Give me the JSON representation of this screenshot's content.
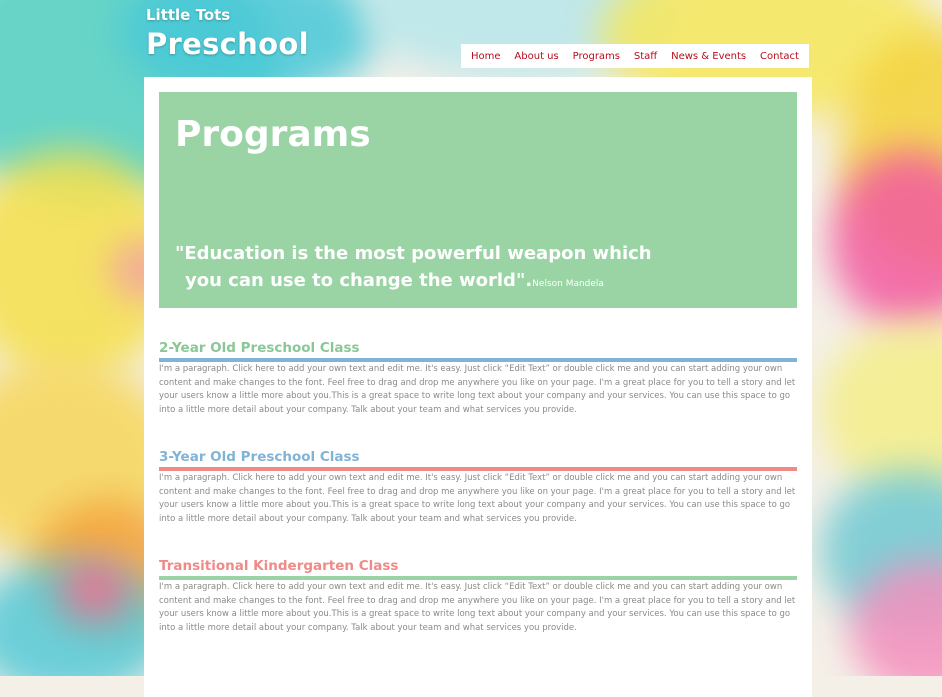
{
  "brand": {
    "small": "Little Tots",
    "big": "Preschool"
  },
  "nav": {
    "items": [
      "Home",
      "About us",
      "Programs",
      "Staff",
      "News & Events",
      "Contact"
    ]
  },
  "hero": {
    "title": "Programs",
    "quote_line1": "\"Education is the most powerful weapon which",
    "quote_line2": "you can use to change the world\".",
    "author": "Nelson Mandela"
  },
  "colors": {
    "green": "#9ad3a4",
    "blue": "#7fb4d6",
    "red": "#f08a87",
    "nav_text": "#b80d1e"
  },
  "sections": [
    {
      "title": "2-Year Old Preschool Class",
      "title_color": "#8ac797",
      "rule_color": "#7fb4d6",
      "text": "I'm a paragraph. Click here to add your own text and edit me. It's easy. Just click “Edit Text” or double click me and you can start adding your own content and make changes to the font. Feel free to drag and drop me anywhere you like on your page. I'm a great place for you to tell a story and let your users know a little more about you.This is a great space to write long text about your company and your services. You can use this space to go into a little more detail about your company. Talk about your team and what services you provide."
    },
    {
      "title": "3-Year Old Preschool Class",
      "title_color": "#7fb4d6",
      "rule_color": "#f08a87",
      "text": "I'm a paragraph. Click here to add your own text and edit me. It's easy. Just click “Edit Text” or double click me and you can start adding your own content and make changes to the font. Feel free to drag and drop me anywhere you like on your page. I'm a great place for you to tell a story and let your users know a little more about you.This is a great space to write long text about your company and your services. You can use this space to go into a little more detail about your company. Talk about your team and what services you provide."
    },
    {
      "title": "Transitional Kindergarten Class",
      "title_color": "#f08a87",
      "rule_color": "#9ad3a4",
      "text": "I'm a paragraph. Click here to add your own text and edit me. It's easy. Just click “Edit Text” or double click me and you can start adding your own content and make changes to the font. Feel free to drag and drop me anywhere you like on your page. I'm a great place for you to tell a story and let your users know a little more about you.This is a great space to write long text about your company and your services. You can use this space to go into a little more detail about your company. Talk about your team and what services you provide."
    }
  ]
}
